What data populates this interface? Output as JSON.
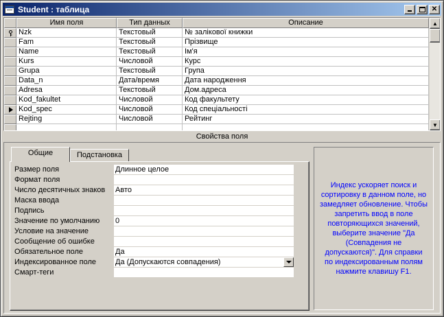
{
  "window": {
    "title": "Student : таблица"
  },
  "grid": {
    "headers": [
      "Имя поля",
      "Тип данных",
      "Описание"
    ],
    "rows": [
      {
        "name": "Nzk",
        "type": "Текстовый",
        "desc": "№  залікової книжки"
      },
      {
        "name": "Fam",
        "type": "Текстовый",
        "desc": "Прізвище"
      },
      {
        "name": "Name",
        "type": "Текстовый",
        "desc": "Ім'я"
      },
      {
        "name": "Kurs",
        "type": "Числовой",
        "desc": "Курс"
      },
      {
        "name": "Grupa",
        "type": "Текстовый",
        "desc": "Група"
      },
      {
        "name": "Data_n",
        "type": "Дата/время",
        "desc": "Дата народження"
      },
      {
        "name": "Adresa",
        "type": "Текстовый",
        "desc": "Дом.адреса"
      },
      {
        "name": "Kod_fakultet",
        "type": "Числовой",
        "desc": "Код факультету"
      },
      {
        "name": "Kod_spec",
        "type": "Числовой",
        "desc": "Код спеціальності"
      },
      {
        "name": "Rejting",
        "type": "Числовой",
        "desc": "Рейтинг"
      },
      {
        "name": "",
        "type": "",
        "desc": ""
      }
    ]
  },
  "props": {
    "title": "Свойства поля",
    "tabs": [
      "Общие",
      "Подстановка"
    ],
    "rows": [
      {
        "label": "Размер поля",
        "value": "Длинное целое"
      },
      {
        "label": "Формат поля",
        "value": ""
      },
      {
        "label": "Число десятичных знаков",
        "value": "Авто"
      },
      {
        "label": "Маска ввода",
        "value": ""
      },
      {
        "label": "Подпись",
        "value": ""
      },
      {
        "label": "Значение по умолчанию",
        "value": "0"
      },
      {
        "label": "Условие на значение",
        "value": ""
      },
      {
        "label": "Сообщение об ошибке",
        "value": ""
      },
      {
        "label": "Обязательное поле",
        "value": "Да"
      },
      {
        "label": "Индексированное поле",
        "value": "Да (Допускаются совпадения)"
      },
      {
        "label": "Смарт-теги",
        "value": ""
      }
    ],
    "help": "Индекс ускоряет поиск и сортировку в данном поле, но замедляет обновление.  Чтобы запретить ввод в поле повторяющихся значений, выберите значение \"Да (Совпадения не допускаются)\".  Для справки по индексированным полям нажмите клавишу F1."
  },
  "colors": {
    "title_start": "#0a246a",
    "title_end": "#a6caf0",
    "help_text": "#0000ff"
  },
  "icons": {
    "key_row": 0,
    "current_row": 8
  }
}
